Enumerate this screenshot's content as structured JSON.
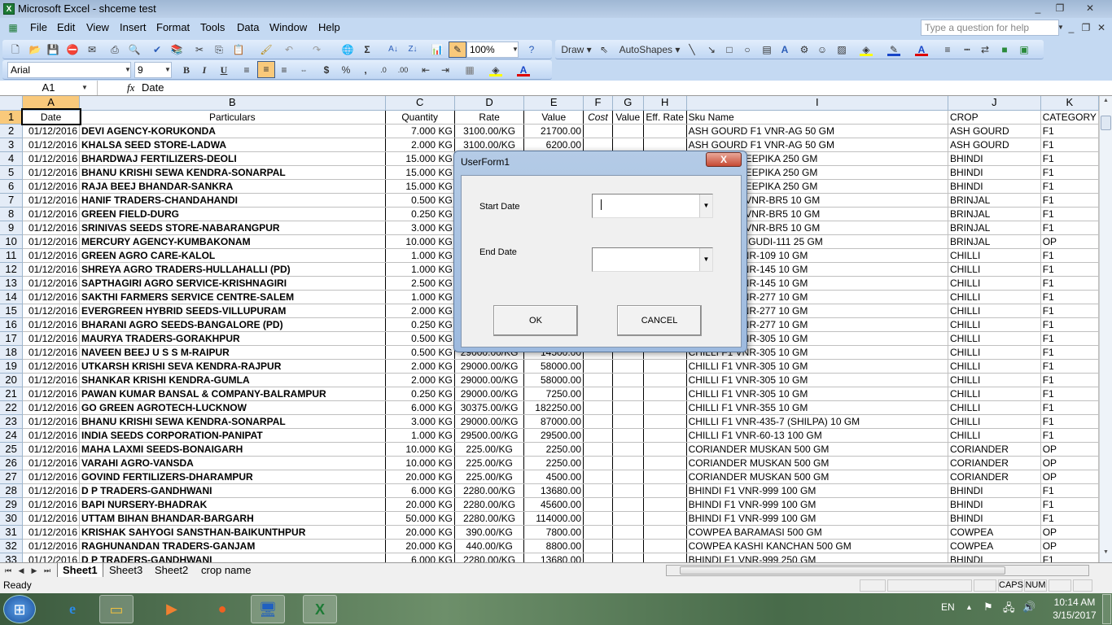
{
  "window": {
    "title": "Microsoft Excel - shceme test",
    "minimize": "_",
    "restore": "❐",
    "close": "✕"
  },
  "menu": {
    "items": [
      "File",
      "Edit",
      "View",
      "Insert",
      "Format",
      "Tools",
      "Data",
      "Window",
      "Help"
    ],
    "help_placeholder": "Type a question for help"
  },
  "toolbar": {
    "zoom": "100%",
    "font": "Arial",
    "size": "9",
    "bold": "B",
    "italic": "I",
    "underline": "U",
    "currency": "$",
    "percent": "%",
    "comma": ",",
    "draw": "Draw ▾",
    "autoshapes": "AutoShapes ▾"
  },
  "formula_bar": {
    "cell_ref": "A1",
    "fx": "fx",
    "content": "Date"
  },
  "sheet": {
    "columns": [
      "A",
      "B",
      "C",
      "D",
      "E",
      "F",
      "G",
      "H",
      "I",
      "J",
      "K"
    ],
    "header": [
      "Date",
      "Particulars",
      "Quantity",
      "Rate",
      "Value",
      "Cost",
      "Value",
      "Eff. Rate",
      "Sku Name",
      "CROP",
      "CATEGORY"
    ],
    "rows": [
      [
        "01/12/2016",
        "DEVI AGENCY-KORUKONDA",
        "7.000 KG",
        "3100.00/KG",
        "21700.00",
        "",
        "",
        "",
        "ASH GOURD F1 VNR-AG 50 GM",
        "ASH GOURD",
        "F1"
      ],
      [
        "01/12/2016",
        "KHALSA SEED STORE-LADWA",
        "2.000 KG",
        "3100.00/KG",
        "6200.00",
        "",
        "",
        "",
        "ASH GOURD F1 VNR-AG 50 GM",
        "ASH GOURD",
        "F1"
      ],
      [
        "01/12/2016",
        "BHARDWAJ FERTILIZERS-DEOLI",
        "15.000 KG",
        "",
        "",
        "",
        "",
        "",
        "BHINDI F1 DEEPIKA 250 GM",
        "BHINDI",
        "F1"
      ],
      [
        "01/12/2016",
        "BHANU KRISHI SEWA KENDRA-SONARPAL",
        "15.000 KG",
        "",
        "",
        "",
        "",
        "",
        "BHINDI F1 DEEPIKA 250 GM",
        "BHINDI",
        "F1"
      ],
      [
        "01/12/2016",
        "RAJA BEEJ BHANDAR-SANKRA",
        "15.000 KG",
        "",
        "",
        "",
        "",
        "",
        "BHINDI F1 DEEPIKA 250 GM",
        "BHINDI",
        "F1"
      ],
      [
        "01/12/2016",
        "HANIF TRADERS-CHANDAHANDI",
        "0.500 KG",
        "",
        "",
        "",
        "",
        "",
        "BRINJAL F1 VNR-BR5 10 GM",
        "BRINJAL",
        "F1"
      ],
      [
        "01/12/2016",
        "GREEN FIELD-DURG",
        "0.250 KG",
        "",
        "",
        "",
        "",
        "",
        "BRINJAL F1 VNR-BR5 10 GM",
        "BRINJAL",
        "F1"
      ],
      [
        "01/12/2016",
        "SRINIVAS SEEDS STORE-NABARANGPUR",
        "3.000 KG",
        "",
        "",
        "",
        "",
        "",
        "BRINJAL F1 VNR-BR5 10 GM",
        "BRINJAL",
        "F1"
      ],
      [
        "01/12/2016",
        "MERCURY AGENCY-KUMBAKONAM",
        "10.000 KG",
        "",
        "",
        "",
        "",
        "",
        "BRINJAL SILIGUDI-111 25 GM",
        "BRINJAL",
        "OP"
      ],
      [
        "01/12/2016",
        "GREEN AGRO CARE-KALOL",
        "1.000 KG",
        "",
        "",
        "",
        "",
        "",
        "CHILLI F1 VNR-109 10 GM",
        "CHILLI",
        "F1"
      ],
      [
        "01/12/2016",
        "SHREYA AGRO TRADERS-HULLAHALLI (PD)",
        "1.000 KG",
        "",
        "",
        "",
        "",
        "",
        "CHILLI F1 VNR-145 10 GM",
        "CHILLI",
        "F1"
      ],
      [
        "01/12/2016",
        "SAPTHAGIRI AGRO SERVICE-KRISHNAGIRI",
        "2.500 KG",
        "",
        "",
        "",
        "",
        "",
        "CHILLI F1 VNR-145 10 GM",
        "CHILLI",
        "F1"
      ],
      [
        "01/12/2016",
        "SAKTHI FARMERS SERVICE CENTRE-SALEM",
        "1.000 KG",
        "",
        "",
        "",
        "",
        "",
        "CHILLI F1 VNR-277 10 GM",
        "CHILLI",
        "F1"
      ],
      [
        "01/12/2016",
        "EVERGREEN HYBRID SEEDS-VILLUPURAM",
        "2.000 KG",
        "",
        "",
        "",
        "",
        "",
        "CHILLI F1 VNR-277 10 GM",
        "CHILLI",
        "F1"
      ],
      [
        "01/12/2016",
        "BHARANI AGRO SEEDS-BANGALORE (PD)",
        "0.250 KG",
        "",
        "",
        "",
        "",
        "",
        "CHILLI F1 VNR-277 10 GM",
        "CHILLI",
        "F1"
      ],
      [
        "01/12/2016",
        "MAURYA TRADERS-GORAKHPUR",
        "0.500 KG",
        "",
        "",
        "",
        "",
        "",
        "CHILLI F1 VNR-305 10 GM",
        "CHILLI",
        "F1"
      ],
      [
        "01/12/2016",
        "NAVEEN BEEJ U S S M-RAIPUR",
        "0.500 KG",
        "29000.00/KG",
        "14500.00",
        "",
        "",
        "",
        "CHILLI F1 VNR-305 10 GM",
        "CHILLI",
        "F1"
      ],
      [
        "01/12/2016",
        "UTKARSH KRISHI SEVA KENDRA-RAJPUR",
        "2.000 KG",
        "29000.00/KG",
        "58000.00",
        "",
        "",
        "",
        "CHILLI F1 VNR-305 10 GM",
        "CHILLI",
        "F1"
      ],
      [
        "01/12/2016",
        "SHANKAR KRISHI KENDRA-GUMLA",
        "2.000 KG",
        "29000.00/KG",
        "58000.00",
        "",
        "",
        "",
        "CHILLI F1 VNR-305 10 GM",
        "CHILLI",
        "F1"
      ],
      [
        "01/12/2016",
        "PAWAN KUMAR BANSAL & COMPANY-BALRAMPUR",
        "0.250 KG",
        "29000.00/KG",
        "7250.00",
        "",
        "",
        "",
        "CHILLI F1 VNR-305 10 GM",
        "CHILLI",
        "F1"
      ],
      [
        "01/12/2016",
        "GO GREEN AGROTECH-LUCKNOW",
        "6.000 KG",
        "30375.00/KG",
        "182250.00",
        "",
        "",
        "",
        "CHILLI F1 VNR-355 10 GM",
        "CHILLI",
        "F1"
      ],
      [
        "01/12/2016",
        "BHANU KRISHI SEWA KENDRA-SONARPAL",
        "3.000 KG",
        "29000.00/KG",
        "87000.00",
        "",
        "",
        "",
        "CHILLI F1 VNR-435-7 (SHILPA) 10 GM",
        "CHILLI",
        "F1"
      ],
      [
        "01/12/2016",
        "INDIA SEEDS CORPORATION-PANIPAT",
        "1.000 KG",
        "29500.00/KG",
        "29500.00",
        "",
        "",
        "",
        "CHILLI F1 VNR-60-13 100 GM",
        "CHILLI",
        "F1"
      ],
      [
        "01/12/2016",
        "MAHA LAXMI SEEDS-BONAIGARH",
        "10.000 KG",
        "225.00/KG",
        "2250.00",
        "",
        "",
        "",
        "CORIANDER MUSKAN 500 GM",
        "CORIANDER",
        "OP"
      ],
      [
        "01/12/2016",
        "VARAHI AGRO-VANSDA",
        "10.000 KG",
        "225.00/KG",
        "2250.00",
        "",
        "",
        "",
        "CORIANDER MUSKAN 500 GM",
        "CORIANDER",
        "OP"
      ],
      [
        "01/12/2016",
        "GOVIND FERTILIZERS-DHARAMPUR",
        "20.000 KG",
        "225.00/KG",
        "4500.00",
        "",
        "",
        "",
        "CORIANDER MUSKAN 500 GM",
        "CORIANDER",
        "OP"
      ],
      [
        "01/12/2016",
        "D P TRADERS-GANDHWANI",
        "6.000 KG",
        "2280.00/KG",
        "13680.00",
        "",
        "",
        "",
        "BHINDI F1 VNR-999 100 GM",
        "BHINDI",
        "F1"
      ],
      [
        "01/12/2016",
        "BAPI NURSERY-BHADRAK",
        "20.000 KG",
        "2280.00/KG",
        "45600.00",
        "",
        "",
        "",
        "BHINDI F1 VNR-999 100 GM",
        "BHINDI",
        "F1"
      ],
      [
        "01/12/2016",
        "UTTAM BIHAN BHANDAR-BARGARH",
        "50.000 KG",
        "2280.00/KG",
        "114000.00",
        "",
        "",
        "",
        "BHINDI F1 VNR-999 100 GM",
        "BHINDI",
        "F1"
      ],
      [
        "01/12/2016",
        "KRISHAK SAHYOGI SANSTHAN-BAIKUNTHPUR",
        "20.000 KG",
        "390.00/KG",
        "7800.00",
        "",
        "",
        "",
        "COWPEA BARAMASI 500 GM",
        "COWPEA",
        "OP"
      ],
      [
        "01/12/2016",
        "RAGHUNANDAN TRADERS-GANJAM",
        "20.000 KG",
        "440.00/KG",
        "8800.00",
        "",
        "",
        "",
        "COWPEA KASHI KANCHAN 500 GM",
        "COWPEA",
        "OP"
      ],
      [
        "01/12/2016",
        "D P TRADERS-GANDHWANI",
        "6.000 KG",
        "2280.00/KG",
        "13680.00",
        "",
        "",
        "",
        "BHINDI F1 VNR-999 250 GM",
        "BHINDI",
        "F1"
      ]
    ]
  },
  "sheet_tabs": [
    "Sheet1",
    "Sheet3",
    "Sheet2",
    "crop name"
  ],
  "status": {
    "text": "Ready",
    "caps": "CAPS",
    "num": "NUM"
  },
  "dialog": {
    "title": "UserForm1",
    "close": "X",
    "start_label": "Start Date",
    "start_value": "",
    "end_label": "End Date",
    "end_value": "",
    "ok": "OK",
    "cancel": "CANCEL"
  },
  "taskbar": {
    "lang": "EN",
    "time": "10:14 AM",
    "date": "3/15/2017"
  }
}
